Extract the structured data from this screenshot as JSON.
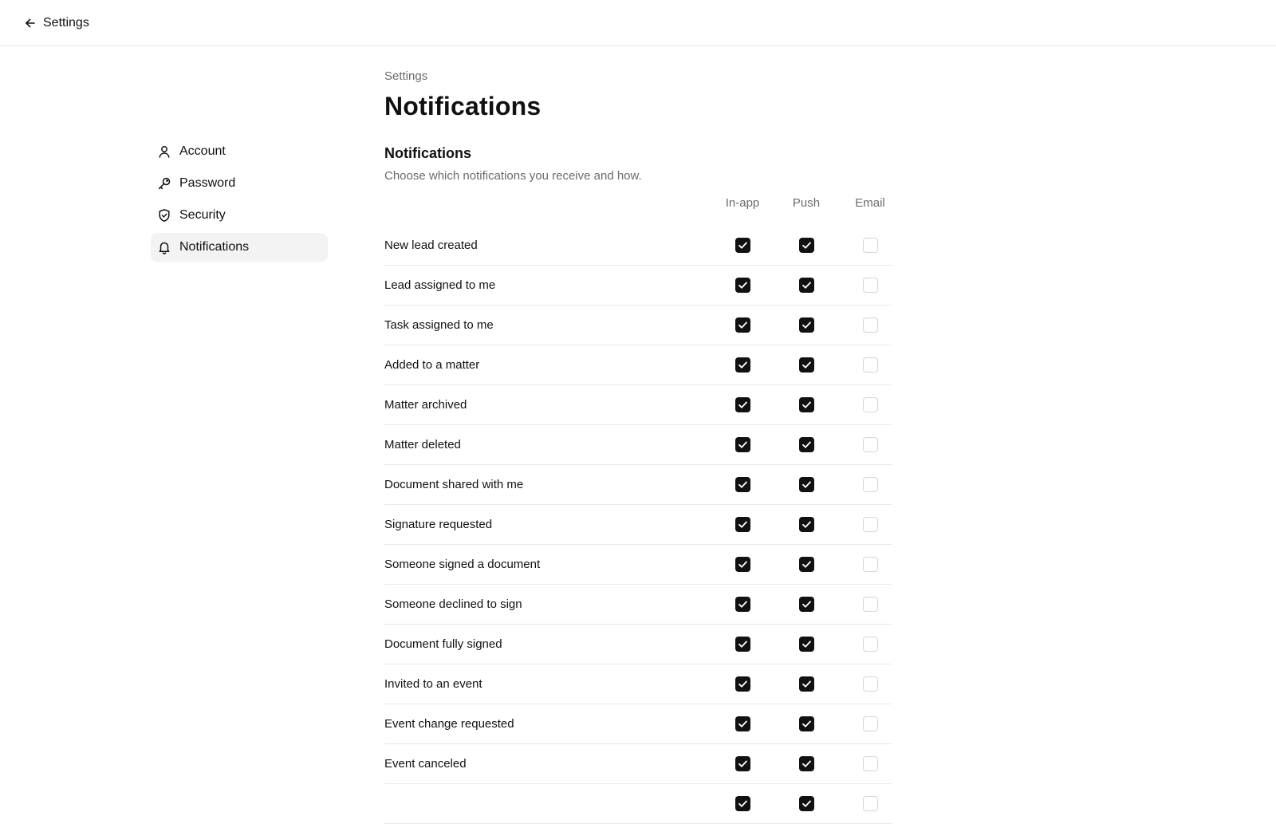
{
  "topbar": {
    "back_label": "Settings"
  },
  "sidebar": {
    "items": [
      {
        "label": "Account",
        "icon": "user-icon",
        "active": false
      },
      {
        "label": "Password",
        "icon": "key-icon",
        "active": false
      },
      {
        "label": "Security",
        "icon": "shield-icon",
        "active": false
      },
      {
        "label": "Notifications",
        "icon": "bell-icon",
        "active": true
      }
    ]
  },
  "main": {
    "breadcrumb": "Settings",
    "title": "Notifications",
    "section_title": "Notifications",
    "section_description": "Choose which notifications you receive and how.",
    "columns": [
      "In-app",
      "Push",
      "Email"
    ],
    "rows": [
      {
        "label": "New lead created",
        "in_app": true,
        "push": true,
        "email": false
      },
      {
        "label": "Lead assigned to me",
        "in_app": true,
        "push": true,
        "email": false
      },
      {
        "label": "Task assigned to me",
        "in_app": true,
        "push": true,
        "email": false
      },
      {
        "label": "Added to a matter",
        "in_app": true,
        "push": true,
        "email": false
      },
      {
        "label": "Matter archived",
        "in_app": true,
        "push": true,
        "email": false
      },
      {
        "label": "Matter deleted",
        "in_app": true,
        "push": true,
        "email": false
      },
      {
        "label": "Document shared with me",
        "in_app": true,
        "push": true,
        "email": false
      },
      {
        "label": "Signature requested",
        "in_app": true,
        "push": true,
        "email": false
      },
      {
        "label": "Someone signed a document",
        "in_app": true,
        "push": true,
        "email": false
      },
      {
        "label": "Someone declined to sign",
        "in_app": true,
        "push": true,
        "email": false
      },
      {
        "label": "Document fully signed",
        "in_app": true,
        "push": true,
        "email": false
      },
      {
        "label": "Invited to an event",
        "in_app": true,
        "push": true,
        "email": false
      },
      {
        "label": "Event change requested",
        "in_app": true,
        "push": true,
        "email": false
      },
      {
        "label": "Event canceled",
        "in_app": true,
        "push": true,
        "email": false
      },
      {
        "label": "",
        "in_app": true,
        "push": true,
        "email": false
      }
    ]
  },
  "colors": {
    "checkbox_checked": "#111111",
    "checkbox_unchecked_border": "#d6d6d6",
    "muted_text": "#6b6b6b",
    "active_nav_bg": "#f3f3f3"
  }
}
